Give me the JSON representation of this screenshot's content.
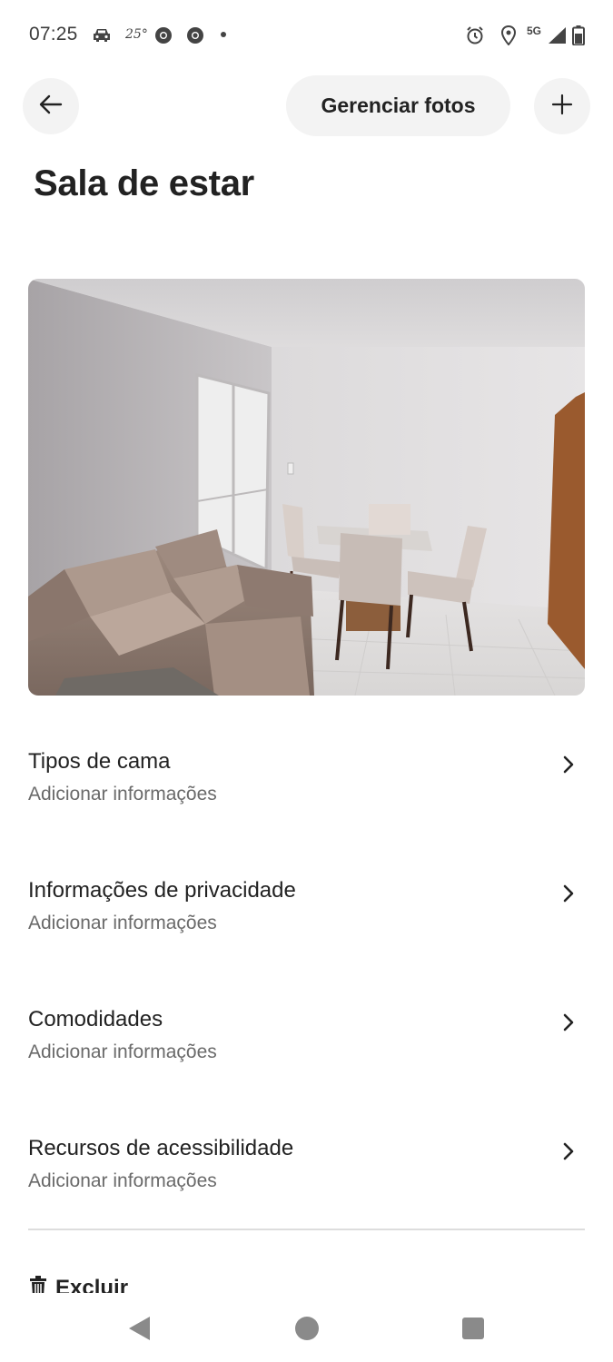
{
  "status_bar": {
    "time": "07:25",
    "temperature": "25°",
    "network": "5G",
    "icons": [
      "car-icon",
      "chrome-icon",
      "chrome-icon",
      "notification-dot",
      "alarm-icon",
      "location-icon",
      "signal-icon",
      "battery-icon"
    ]
  },
  "header": {
    "back_icon": "arrow-left-icon",
    "manage_photos_label": "Gerenciar fotos",
    "add_icon": "plus-icon"
  },
  "page": {
    "title": "Sala de estar"
  },
  "photo": {
    "subject": "living room photo"
  },
  "rows": [
    {
      "title": "Tipos de cama",
      "subtitle": "Adicionar informações"
    },
    {
      "title": "Informações de privacidade",
      "subtitle": "Adicionar informações"
    },
    {
      "title": "Comodidades",
      "subtitle": "Adicionar informações"
    },
    {
      "title": "Recursos de acessibilidade",
      "subtitle": "Adicionar informações"
    }
  ],
  "delete": {
    "label": "Excluir",
    "icon": "trash-icon"
  },
  "nav_bar": {
    "icons": [
      "back-triangle-icon",
      "home-circle-icon",
      "recents-square-icon"
    ]
  },
  "colors": {
    "text": "#222222",
    "secondary_text": "#6a6a6a",
    "button_bg": "#f3f3f3",
    "divider": "#dddddd"
  }
}
